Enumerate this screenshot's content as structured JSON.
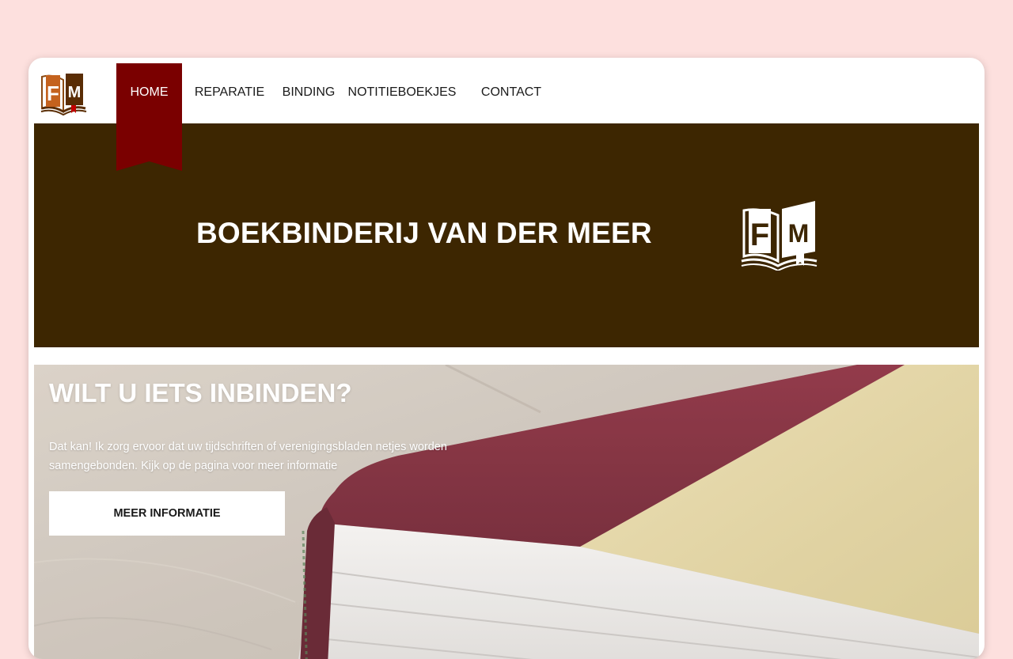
{
  "site": {
    "logo_letters": "FM",
    "brand_color": "#3d2601",
    "accent_color": "#7a0000"
  },
  "nav": {
    "items": [
      {
        "label": "HOME",
        "active": true
      },
      {
        "label": "REPARATIE",
        "active": false
      },
      {
        "label": "BINDING",
        "active": false
      },
      {
        "label": "NOTITIEBOEKJES",
        "active": false
      },
      {
        "label": "CONTACT",
        "active": false
      }
    ]
  },
  "hero": {
    "title": "BOEKBINDERIJ VAN DER MEER",
    "logo_icon": "fm-book-logo-icon"
  },
  "feature": {
    "title": "WILT U IETS INBINDEN?",
    "text": "Dat kan! Ik zorg ervoor dat uw tijdschriften of verenigingsbladen netjes worden samengebonden. Kijk op de pagina voor meer informatie",
    "button_label": "MEER INFORMATIE",
    "image": "bound-book-photo"
  }
}
